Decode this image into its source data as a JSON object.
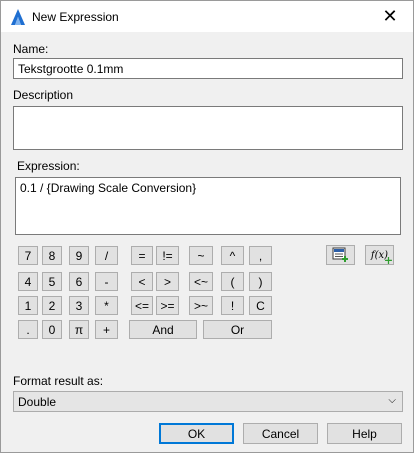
{
  "window": {
    "title": "New Expression",
    "close_glyph": "✕"
  },
  "name": {
    "label": "Name:",
    "value": "Tekstgrootte 0.1mm"
  },
  "description": {
    "label": "Description",
    "value": ""
  },
  "expression": {
    "label": "Expression:",
    "value": "0.1 / {Drawing Scale Conversion}"
  },
  "keypad": {
    "k7": "7",
    "k8": "8",
    "k9": "9",
    "div": "/",
    "eq": "=",
    "neq": "!=",
    "approx": "~",
    "caret": "^",
    "comma": ",",
    "k4": "4",
    "k5": "5",
    "k6": "6",
    "minus": "-",
    "lt": "<",
    "gt": ">",
    "ltapprox": "<~",
    "lparen": "(",
    "rparen": ")",
    "k1": "1",
    "k2": "2",
    "k3": "3",
    "mul": "*",
    "lte": "<=",
    "gte": ">=",
    "gtapprox": ">~",
    "not": "!",
    "clear": "C",
    "dot": ".",
    "k0": "0",
    "pi": "π",
    "plus": "+",
    "and": "And",
    "or": "Or"
  },
  "tools": {
    "insert_property_icon": "insert-property-icon",
    "insert_function_label": "f(x)"
  },
  "format": {
    "label": "Format result as:",
    "selected": "Double"
  },
  "buttons": {
    "ok": "OK",
    "cancel": "Cancel",
    "help": "Help"
  },
  "colors": {
    "accent": "#0078d7",
    "icon_green": "#2f9e2f"
  }
}
